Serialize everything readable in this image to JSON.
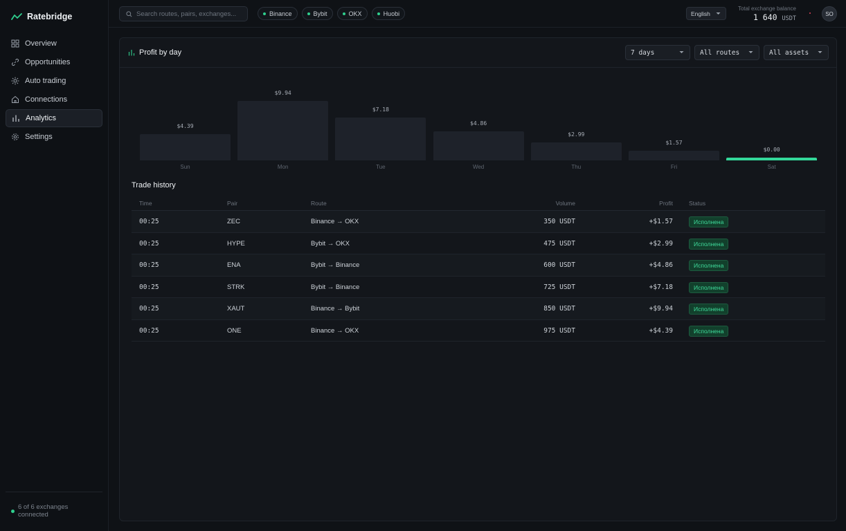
{
  "brand": {
    "name": "Ratebridge"
  },
  "nav": [
    {
      "label": "Overview",
      "icon": "grid-icon"
    },
    {
      "label": "Opportunities",
      "icon": "link-icon"
    },
    {
      "label": "Auto trading",
      "icon": "sun-icon"
    },
    {
      "label": "Connections",
      "icon": "home-icon"
    },
    {
      "label": "Analytics",
      "icon": "bar-chart-icon",
      "active": true
    },
    {
      "label": "Settings",
      "icon": "gear-icon"
    }
  ],
  "sidebar_footer": {
    "text": "6 of 6 exchanges connected"
  },
  "search": {
    "placeholder": "Search routes, pairs, exchanges..."
  },
  "exchanges": [
    "Binance",
    "Bybit",
    "OKX",
    "Huobi"
  ],
  "language": "English",
  "balance": {
    "label": "Total exchange balance",
    "value": "1 640",
    "unit": "USDT"
  },
  "user": {
    "initials": "SO"
  },
  "panel": {
    "title": "Profit by day",
    "filters": {
      "period": "7 days",
      "routes": "All routes",
      "assets": "All assets"
    }
  },
  "chart_data": {
    "type": "bar",
    "categories": [
      "Sun",
      "Mon",
      "Tue",
      "Wed",
      "Thu",
      "Fri",
      "Sat"
    ],
    "values": [
      4.39,
      9.94,
      7.18,
      4.86,
      2.99,
      1.57,
      0.0
    ],
    "labels": [
      "$4.39",
      "$9.94",
      "$7.18",
      "$4.86",
      "$2.99",
      "$1.57",
      "$0.00"
    ],
    "highlight": "Sat",
    "colors": {
      "bar": "#1e222a",
      "highlight": "#33d89a"
    }
  },
  "trade_history": {
    "title": "Trade history",
    "columns": [
      "Time",
      "Pair",
      "Route",
      "Volume",
      "Profit",
      "Status"
    ],
    "rows": [
      {
        "time": "00:25",
        "pair": "ZEC",
        "route": "Binance → OKX",
        "volume": "350 USDT",
        "profit": "+$1.57",
        "status": "Исполнена"
      },
      {
        "time": "00:25",
        "pair": "HYPE",
        "route": "Bybit → OKX",
        "volume": "475 USDT",
        "profit": "+$2.99",
        "status": "Исполнена"
      },
      {
        "time": "00:25",
        "pair": "ENA",
        "route": "Bybit → Binance",
        "volume": "600 USDT",
        "profit": "+$4.86",
        "status": "Исполнена"
      },
      {
        "time": "00:25",
        "pair": "STRK",
        "route": "Bybit → Binance",
        "volume": "725 USDT",
        "profit": "+$7.18",
        "status": "Исполнена"
      },
      {
        "time": "00:25",
        "pair": "XAUT",
        "route": "Binance → Bybit",
        "volume": "850 USDT",
        "profit": "+$9.94",
        "status": "Исполнена"
      },
      {
        "time": "00:25",
        "pair": "ONE",
        "route": "Binance → OKX",
        "volume": "975 USDT",
        "profit": "+$4.39",
        "status": "Исполнена"
      }
    ]
  },
  "colors": {
    "accent": "#2fcf8e",
    "background": "#0f1216",
    "notification": "#e0455a"
  }
}
